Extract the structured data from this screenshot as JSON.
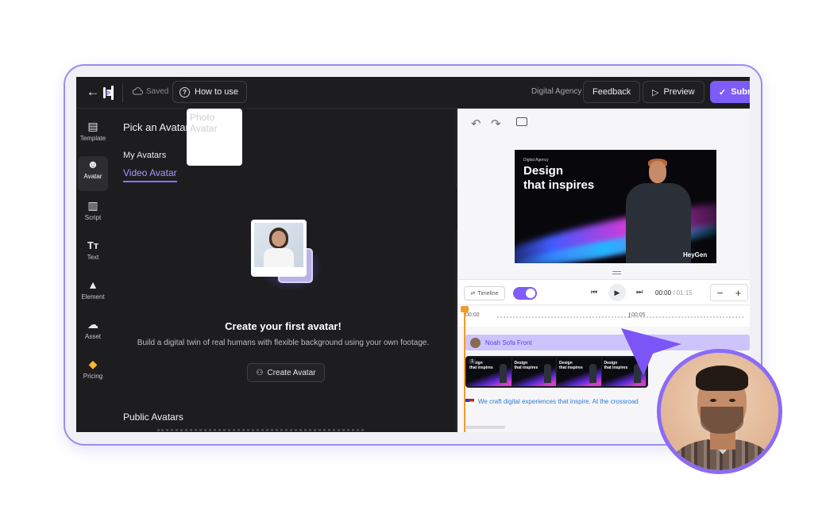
{
  "topbar": {
    "saved_label": "Saved",
    "how_to_label": "How to use",
    "workspace": "Digital Agency",
    "feedback_label": "Feedback",
    "preview_label": "Preview",
    "submit_label": "Subm"
  },
  "sidebar": {
    "items": [
      {
        "label": "Template",
        "icon": "template-icon"
      },
      {
        "label": "Avatar",
        "icon": "avatar-icon"
      },
      {
        "label": "Script",
        "icon": "script-icon"
      },
      {
        "label": "Text",
        "icon": "text-icon"
      },
      {
        "label": "Element",
        "icon": "element-icon"
      },
      {
        "label": "Asset",
        "icon": "upload-cloud-icon"
      },
      {
        "label": "Pricing",
        "icon": "diamond-icon"
      }
    ]
  },
  "panel": {
    "title": "Pick an Avatar",
    "my_avatars": "My Avatars",
    "tabs": [
      "Video Avatar",
      "Photo Avatar"
    ],
    "empty_title": "Create your first avatar!",
    "empty_sub": "Build a digital twin of real humans with flexible background using your own footage.",
    "create_label": "Create Avatar",
    "public_avatars": "Public Avatars"
  },
  "preview": {
    "kicker": "Digital Agency",
    "headline_1": "Design",
    "headline_2": "that inspires",
    "brand": "HeyGen"
  },
  "timeline": {
    "toggle_label": "Timeline",
    "current_time": "00:00",
    "total_time": "/ 01:15",
    "ruler_start": "00:00",
    "ruler_mid": "00:05",
    "avatar_track": "Noah Sofa Front",
    "scene_badge": "1",
    "scene_text_1": "Design",
    "scene_text_2": "that inspires",
    "script_text": "We craft digital experiences that inspire. At the crossroad"
  },
  "colors": {
    "accent": "#7d5cf7",
    "editor_bg": "#1d1d20",
    "avatar_track_bg": "#cdc4fb",
    "playhead": "#f29b2b"
  }
}
